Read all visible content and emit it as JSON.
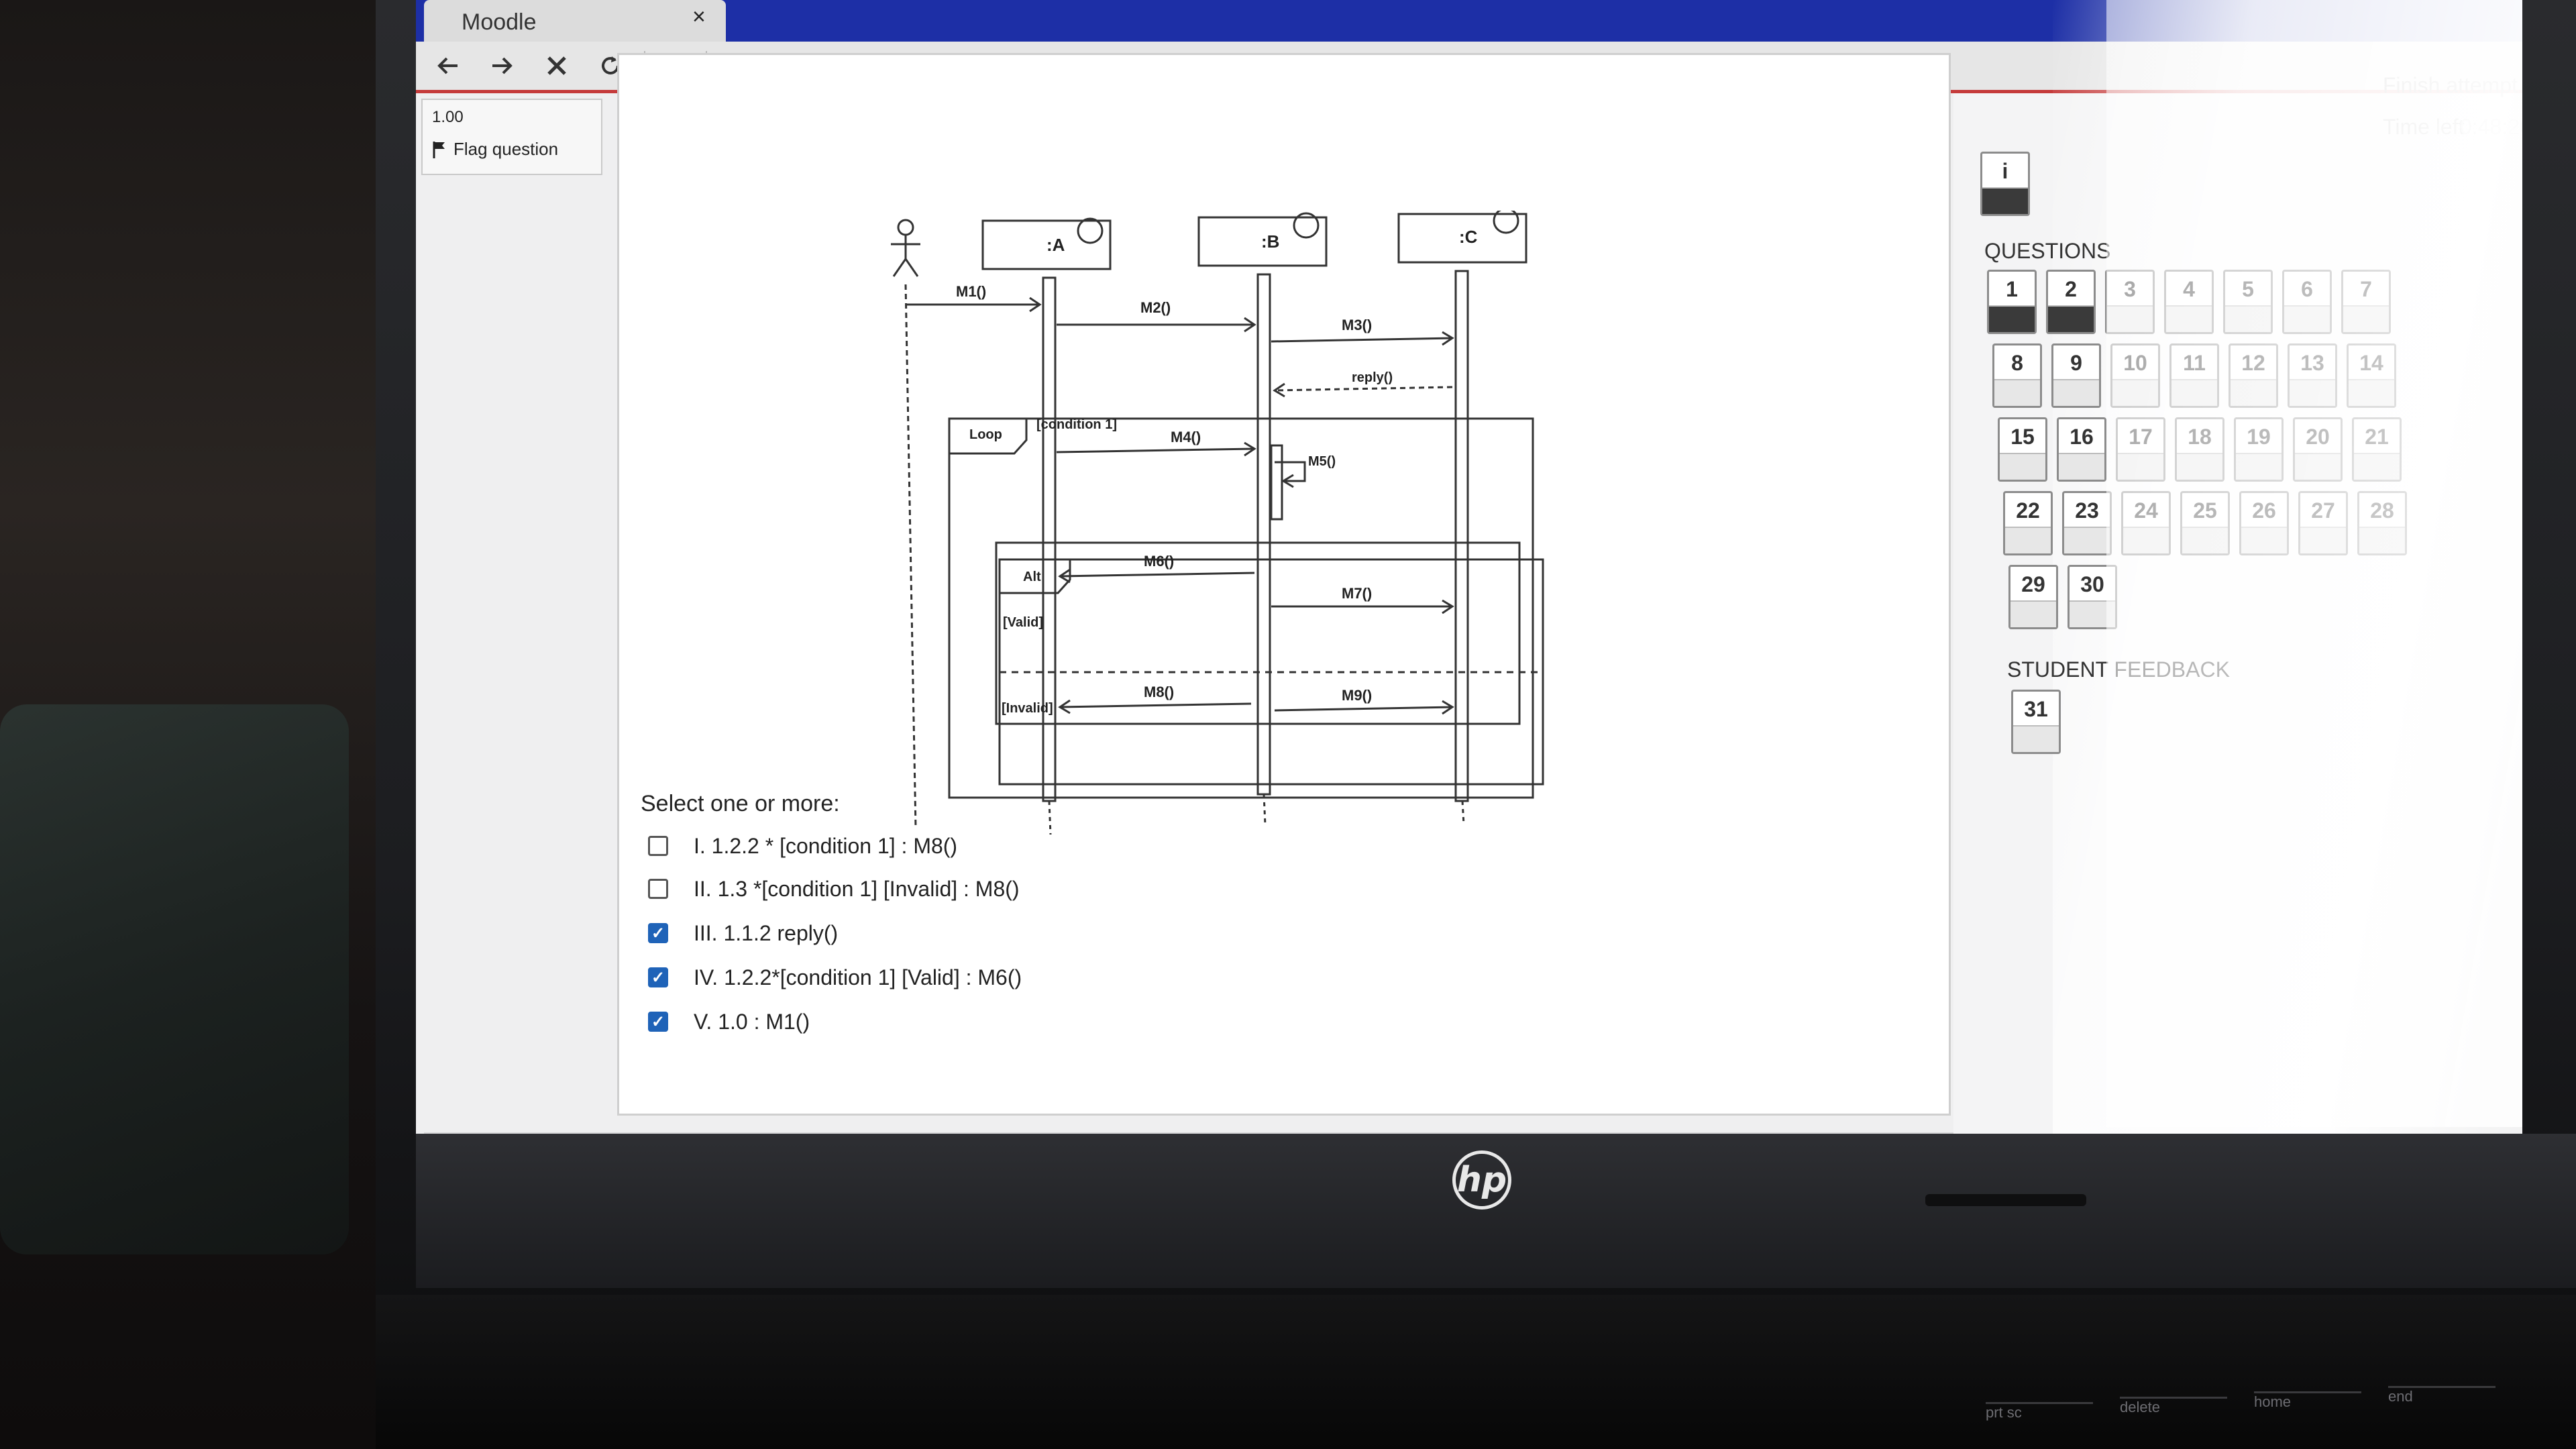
{
  "browser": {
    "tab_title": "Moodle",
    "tab_close": "×",
    "toolbar_icons": [
      "back-arrow-icon",
      "forward-arrow-icon",
      "stop-icon",
      "reload-icon",
      "info-icon",
      "page-icon"
    ]
  },
  "question_info": {
    "grade": "1.00",
    "flag_label": "Flag question"
  },
  "diagram": {
    "lifelines": [
      ":A",
      ":B",
      ":C"
    ],
    "messages": [
      "M1()",
      "M2()",
      "M3()",
      "reply()",
      "M4()",
      "M5()",
      "M6()",
      "M7()",
      "M8()",
      "M9()"
    ],
    "frames": {
      "loop_label": "Loop",
      "loop_guard": "[condition 1]",
      "alt_label": "Alt",
      "alt_guard_1": "[Valid]",
      "alt_guard_2": "[Invalid]"
    }
  },
  "question": {
    "prompt": "Select one or more:",
    "options": [
      {
        "label": "I. 1.2.2 * [condition 1] : M8()",
        "checked": false
      },
      {
        "label": "II. 1.3 *[condition 1] [Invalid] : M8()",
        "checked": false
      },
      {
        "label": "III. 1.1.2 reply()",
        "checked": true
      },
      {
        "label": "IV. 1.2.2*[condition 1] [Valid] : M6()",
        "checked": true
      },
      {
        "label": "V. 1.0 : M1()",
        "checked": true
      }
    ]
  },
  "quiz_nav": {
    "finish_attempt": "Finish attempt",
    "time_left_label": "Time left",
    "time_left_value": "0:48:26",
    "info_button": "i",
    "questions_heading": "QUESTIONS",
    "feedback_heading": "STUDENT FEEDBACK",
    "rows": [
      [
        "1",
        "2",
        "3",
        "4",
        "5",
        "6",
        "7"
      ],
      [
        "8",
        "9",
        "10",
        "11",
        "12",
        "13",
        "14"
      ],
      [
        "15",
        "16",
        "17",
        "18",
        "19",
        "20",
        "21"
      ],
      [
        "22",
        "23",
        "24",
        "25",
        "26",
        "27",
        "28"
      ],
      [
        "29",
        "30"
      ]
    ],
    "answered": [
      "1",
      "2"
    ],
    "feedback_buttons": [
      "31"
    ]
  },
  "device": {
    "brand_logo": "hp",
    "keys": [
      "prt sc",
      "delete",
      "home",
      "end"
    ]
  }
}
